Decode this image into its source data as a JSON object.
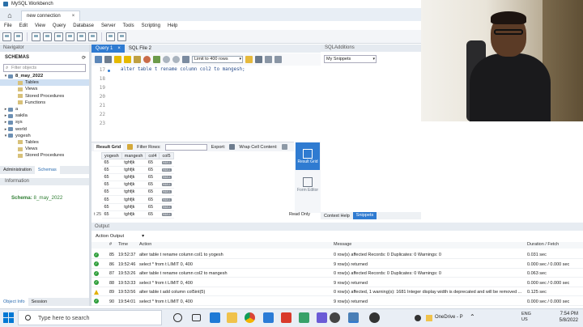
{
  "window": {
    "title": "MySQL Workbench"
  },
  "connection_tab": {
    "label": "new connection",
    "close": "×"
  },
  "menu": [
    "File",
    "Edit",
    "View",
    "Query",
    "Database",
    "Server",
    "Tools",
    "Scripting",
    "Help"
  ],
  "navigator": {
    "title": "Navigator",
    "schemas_label": "SCHEMAS",
    "filter_placeholder": "Filter objects",
    "tree": [
      {
        "label": "8_may_2022",
        "level": 0,
        "kind": "db",
        "expanded": true,
        "bold": true
      },
      {
        "label": "Tables",
        "level": 1,
        "kind": "folder",
        "selected": true
      },
      {
        "label": "Views",
        "level": 1,
        "kind": "folder"
      },
      {
        "label": "Stored Procedures",
        "level": 1,
        "kind": "folder"
      },
      {
        "label": "Functions",
        "level": 1,
        "kind": "folder"
      },
      {
        "label": "a",
        "level": 0,
        "kind": "db"
      },
      {
        "label": "sakila",
        "level": 0,
        "kind": "db"
      },
      {
        "label": "sys",
        "level": 0,
        "kind": "db"
      },
      {
        "label": "world",
        "level": 0,
        "kind": "db"
      },
      {
        "label": "yogesh",
        "level": 0,
        "kind": "db",
        "expanded": true
      },
      {
        "label": "Tables",
        "level": 1,
        "kind": "folder"
      },
      {
        "label": "Views",
        "level": 1,
        "kind": "folder"
      },
      {
        "label": "Stored Procedures",
        "level": 1,
        "kind": "folder"
      }
    ],
    "tabs": [
      "Administration",
      "Schemas"
    ],
    "active_tab": "Schemas",
    "info_title": "Information",
    "info_schema_key": "Schema:",
    "info_schema_value": "8_may_2022",
    "bottom_tabs": [
      "Object Info",
      "Session"
    ]
  },
  "editor": {
    "tabs": [
      "Query 1",
      "SQL File 2"
    ],
    "limit": "Limit to 400 rows",
    "line_numbers": [
      "17",
      "18",
      "19",
      "20",
      "21",
      "22",
      "23"
    ],
    "code_line": "alter table t rename  column col2 to mangesh;"
  },
  "result_grid": {
    "tab_label": "Result Grid",
    "filter_label": "Filter Rows:",
    "export_label": "Export:",
    "wrap_label": "Wrap Cell Content:",
    "columns": [
      "yogesh",
      "mangesh",
      "col4",
      "col5"
    ],
    "rows": [
      [
        "65",
        "tghfjk",
        "65",
        "NULL"
      ],
      [
        "65",
        "tghfjk",
        "65",
        "NULL"
      ],
      [
        "65",
        "tghfjk",
        "65",
        "NULL"
      ],
      [
        "65",
        "tghfjk",
        "65",
        "NULL"
      ],
      [
        "65",
        "tghfjk",
        "65",
        "NULL"
      ],
      [
        "65",
        "tghfjk",
        "65",
        "NULL"
      ],
      [
        "65",
        "tghfjk",
        "65",
        "NULL"
      ],
      [
        "65",
        "tghfjk",
        "65",
        "NULL"
      ]
    ],
    "status": "t 25",
    "readonly": "Read Only",
    "side": {
      "grid": "Result Grid",
      "form": "Form Editor"
    }
  },
  "additions": {
    "title": "SQLAdditions",
    "snippets": "My Snippets",
    "tabs": [
      "Context Help",
      "Snippets"
    ],
    "active_tab": "Snippets"
  },
  "output": {
    "title": "Output",
    "selector": "Action Output",
    "columns": {
      "num": "#",
      "time": "Time",
      "action": "Action",
      "message": "Message",
      "duration": "Duration / Fetch"
    },
    "rows": [
      {
        "status": "ok",
        "num": "85",
        "time": "19:52:37",
        "action": "alter table t rename  column col1 to yogesh",
        "message": "0 row(s) affected Records: 0  Duplicates: 0  Warnings: 0",
        "duration": "0.031 sec"
      },
      {
        "status": "ok",
        "num": "86",
        "time": "19:52:46",
        "action": "select * from t LIMIT 0, 400",
        "message": "9 row(s) returned",
        "duration": "0.000 sec / 0.000 sec"
      },
      {
        "status": "ok",
        "num": "87",
        "time": "19:53:26",
        "action": "alter table t rename  column col2 to mangesh",
        "message": "0 row(s) affected Records: 0  Duplicates: 0  Warnings: 0",
        "duration": "0.063 sec"
      },
      {
        "status": "ok",
        "num": "88",
        "time": "19:53:33",
        "action": "select * from t LIMIT 0, 400",
        "message": "9 row(s) returned",
        "duration": "0.000 sec / 0.000 sec"
      },
      {
        "status": "warn",
        "num": "89",
        "time": "19:53:56",
        "action": "alter table t add column col5int(5)",
        "message": "0 row(s) affected, 1 warning(s): 1681 Integer display width is deprecated and will be removed ...",
        "duration": "0.125 sec"
      },
      {
        "status": "ok",
        "num": "90",
        "time": "19:54:01",
        "action": "select * from t LIMIT 0, 400",
        "message": "9 row(s) returned",
        "duration": "0.000 sec / 0.000 sec"
      }
    ]
  },
  "taskbar": {
    "search_placeholder": "Type here to search",
    "onedrive": "OneDrive - P",
    "lang": "ENG",
    "region": "US",
    "time": "7:54 PM",
    "date": "5/8/2022"
  }
}
